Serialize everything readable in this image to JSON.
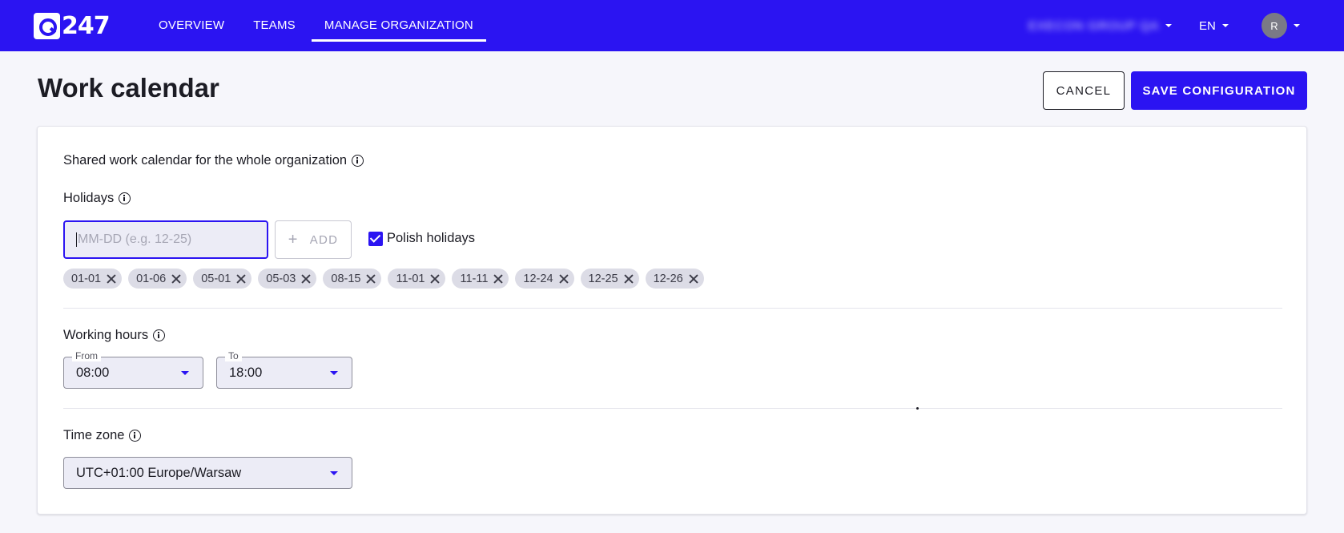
{
  "brand": {
    "logo_text": "247"
  },
  "nav": [
    {
      "label": "OVERVIEW"
    },
    {
      "label": "TEAMS"
    },
    {
      "label": "MANAGE ORGANIZATION"
    }
  ],
  "org_selector": {
    "label": "EXECON GROUP QA"
  },
  "language": {
    "label": "EN"
  },
  "user": {
    "avatar_initial": "R"
  },
  "page": {
    "title": "Work calendar",
    "cancel_label": "CANCEL",
    "save_label": "SAVE CONFIGURATION"
  },
  "calendar": {
    "description": "Shared work calendar for the whole organization",
    "holidays": {
      "label": "Holidays",
      "input_placeholder": "MM-DD (e.g. 12-25)",
      "add_label": "ADD",
      "polish_holidays_label": "Polish holidays",
      "polish_holidays_checked": true,
      "dates": [
        "01-01",
        "01-06",
        "05-01",
        "05-03",
        "08-15",
        "11-01",
        "11-11",
        "12-24",
        "12-25",
        "12-26"
      ]
    },
    "working_hours": {
      "label": "Working hours",
      "from_label": "From",
      "from_value": "08:00",
      "to_label": "To",
      "to_value": "18:00"
    },
    "time_zone": {
      "label": "Time zone",
      "value": "UTC+01:00 Europe/Warsaw"
    }
  },
  "colors": {
    "primary": "#2b14f2",
    "chip_bg": "#dcdce6",
    "page_bg": "#f6f6fb"
  }
}
